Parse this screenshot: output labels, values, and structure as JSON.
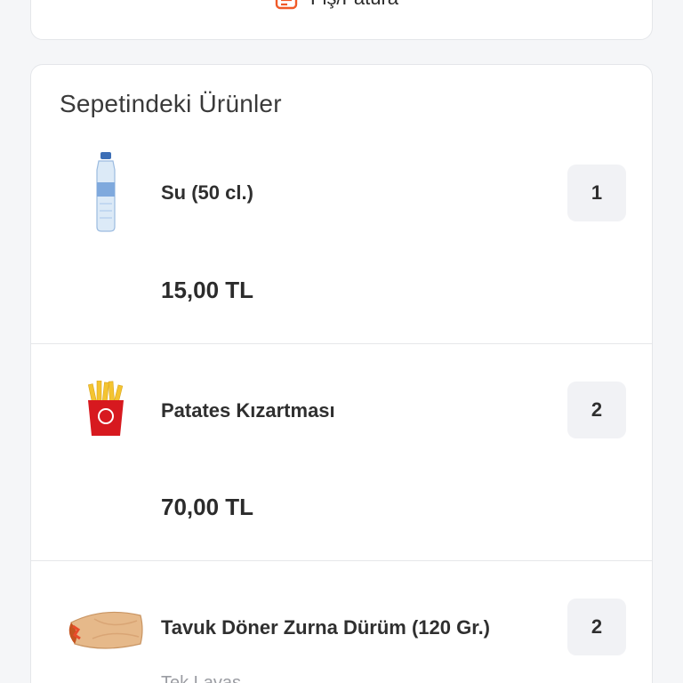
{
  "receipt": {
    "label": "Fiş/Fatura",
    "icon": "receipt-icon",
    "accent": "#f05a28"
  },
  "cart": {
    "title": "Sepetindeki Ürünler",
    "items": [
      {
        "name": "Su (50 cl.)",
        "price": "15,00 TL",
        "quantity": "1",
        "icon": "water-bottle-icon"
      },
      {
        "name": "Patates Kızartması",
        "price": "70,00 TL",
        "quantity": "2",
        "icon": "french-fries-icon"
      },
      {
        "name": "Tavuk Döner Zurna Dürüm (120 Gr.)",
        "quantity": "2",
        "subtext": "Tek Lavaş",
        "icon": "durum-wrap-icon"
      }
    ]
  }
}
